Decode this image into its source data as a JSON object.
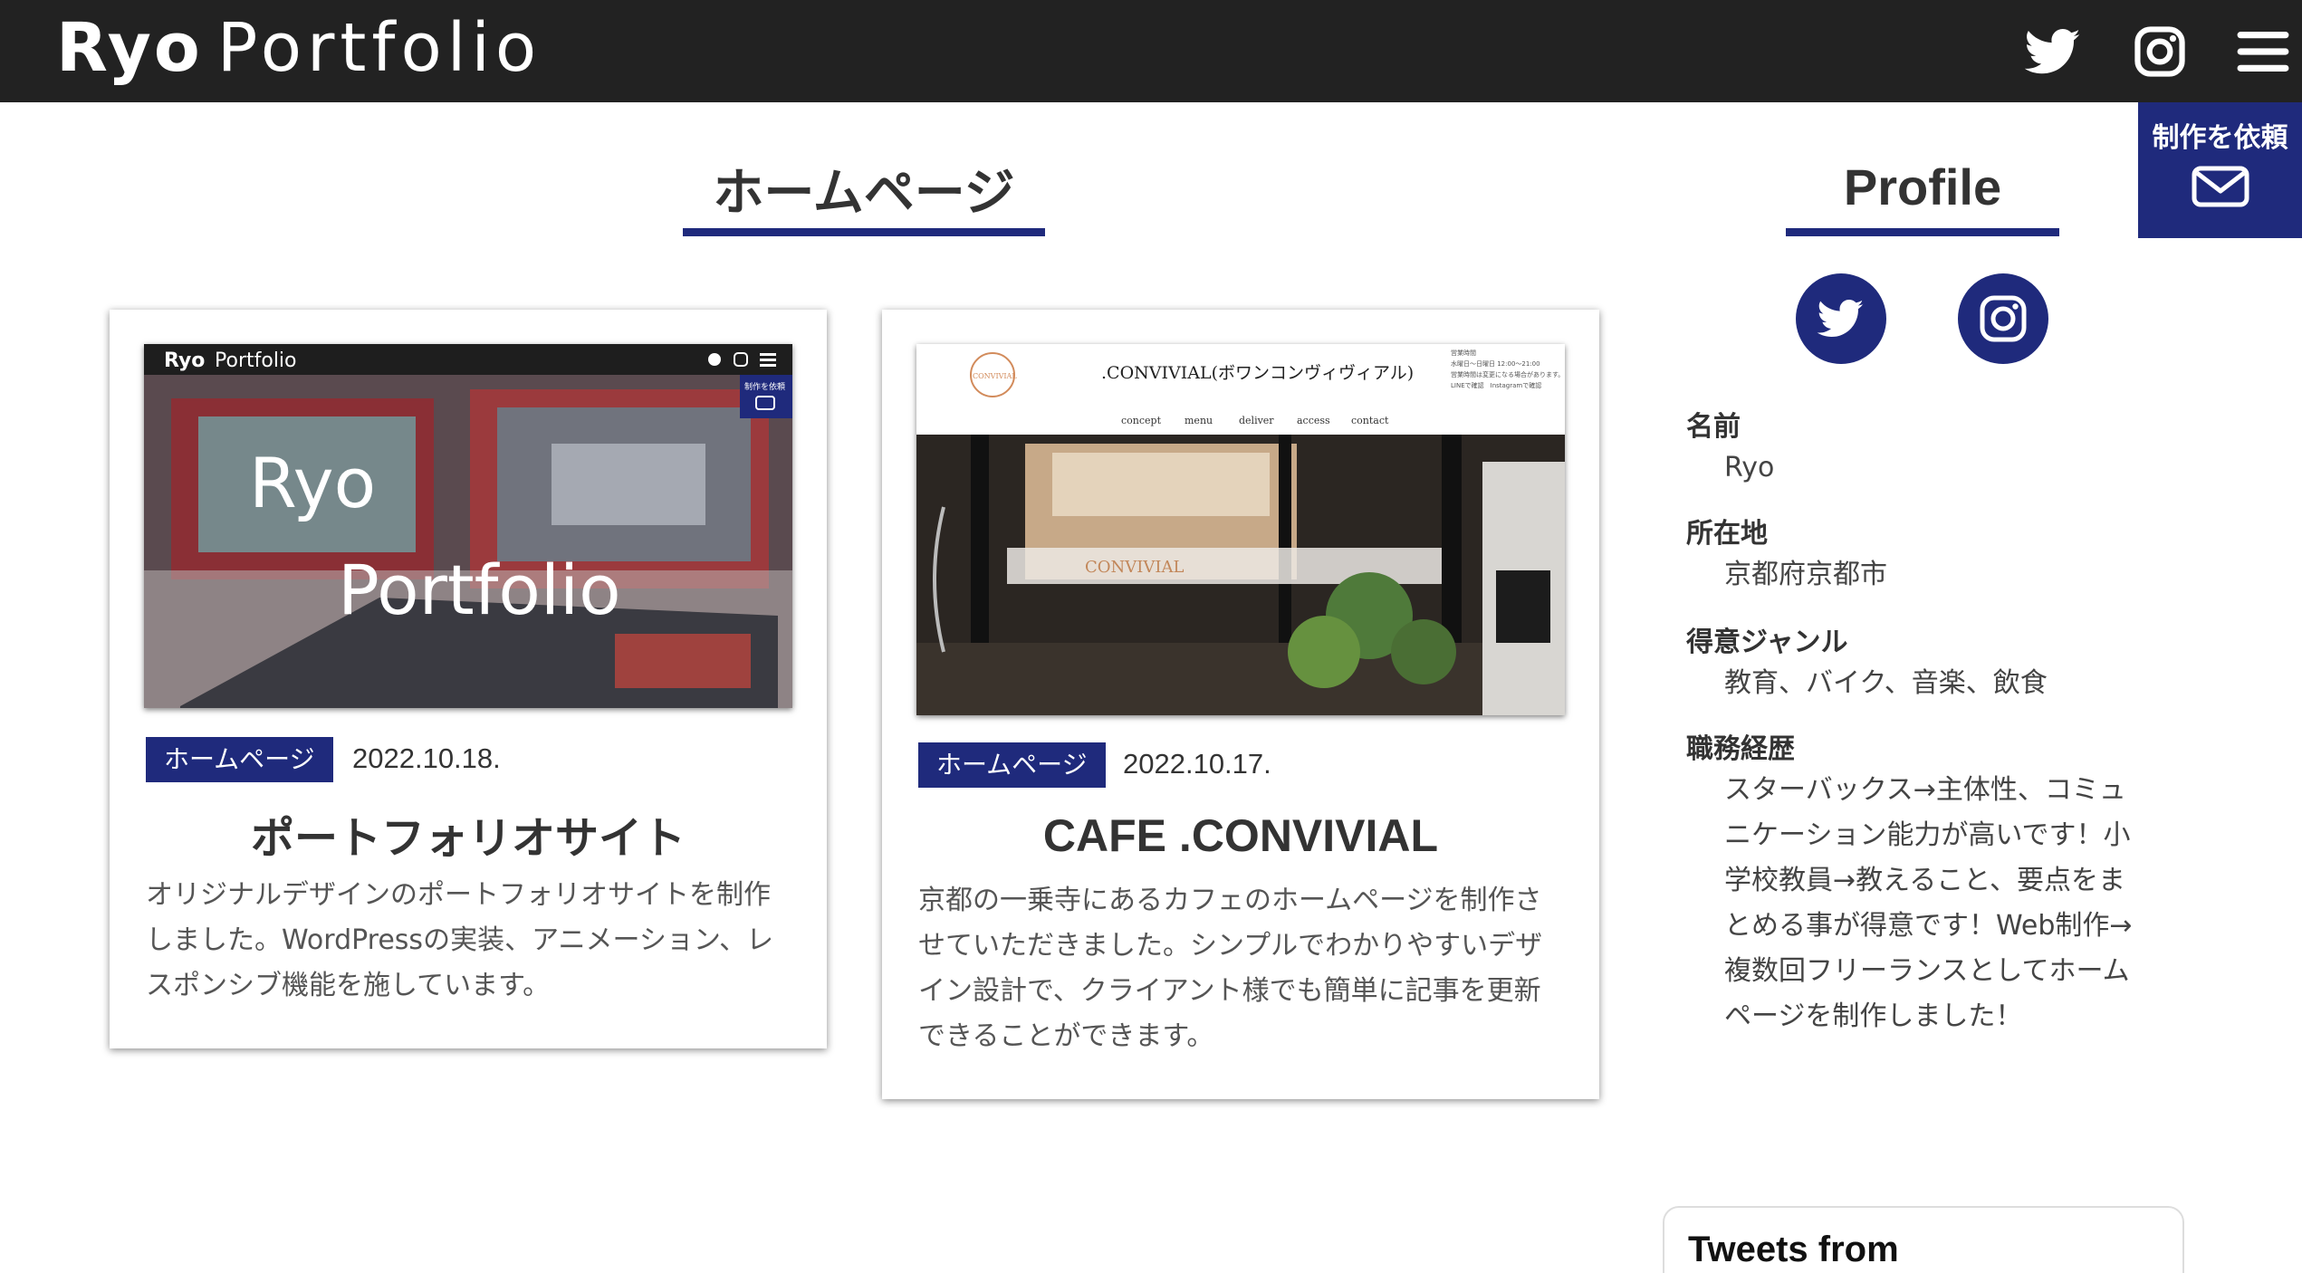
{
  "header": {
    "logo_bold": "Ryo",
    "logo_thin": "Portfolio",
    "icons": [
      "twitter-icon",
      "instagram-icon",
      "hamburger-menu-icon"
    ]
  },
  "request_button": {
    "label": "制作を依頼",
    "icon": "envelope-icon"
  },
  "main": {
    "section_title": "ホームページ",
    "cards": [
      {
        "badge": "ホームページ",
        "date": "2022.10.18.",
        "title": "ポートフォリオサイト",
        "description": "オリジナルデザインのポートフォリオサイトを制作しました。WordPressの実装、アニメーション、レスポンシブ機能を施しています。",
        "thumbnail": {
          "logo_bold": "Ryo",
          "logo_thin": "Portfolio",
          "request_label": "制作を依頼",
          "hero_line1": "Ryo",
          "hero_line2": "Portfolio"
        }
      },
      {
        "badge": "ホームページ",
        "date": "2022.10.17.",
        "title": "CAFE .CONVIVIAL",
        "description": "京都の一乗寺にあるカフェのホームページを制作させていただきました。シンプルでわかりやすいデザイン設計で、クライアント様でも簡単に記事を更新できることができます。",
        "thumbnail": {
          "site_title": ".CONVIVIAL(ボワンコンヴィヴィアル)",
          "logo_text": "CONVIVIAL",
          "hours_line1": "営業時間",
          "hours_line2": "水曜日〜日曜日 12:00〜21:00",
          "hours_line3": "営業時間は変更になる場合があります。",
          "hours_line4": "LINEで確認　Instagramで確認",
          "nav": [
            "concept",
            "menu",
            "deliver",
            "access",
            "contact"
          ],
          "window_text": "CONVIVIAL"
        }
      }
    ]
  },
  "profile": {
    "title": "Profile",
    "social": [
      "twitter-icon",
      "instagram-icon"
    ],
    "fields": [
      {
        "label": "名前",
        "value": "Ryo"
      },
      {
        "label": "所在地",
        "value": "京都府京都市"
      },
      {
        "label": "得意ジャンル",
        "value": "教育、バイク、音楽、飲食"
      },
      {
        "label": "職務経歴",
        "value": "スターバックス→主体性、コミュニケーション能力が高いです！小学校教員→教えること、要点をまとめる事が得意です！Web制作→複数回フリーランスとしてホームページを制作しました！"
      }
    ]
  },
  "tweets": {
    "title": "Tweets from"
  },
  "colors": {
    "header_bg": "#222222",
    "accent": "#1f2a7c",
    "text": "#333333"
  }
}
